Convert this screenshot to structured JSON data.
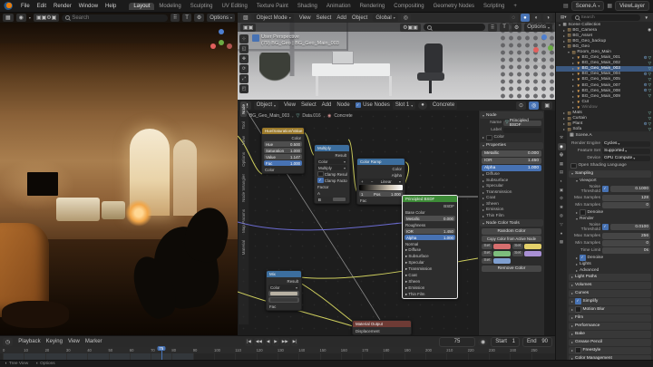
{
  "topbar": {
    "menus": [
      "File",
      "Edit",
      "Render",
      "Window",
      "Help"
    ],
    "workspaces": [
      "Layout",
      "Modeling",
      "Sculpting",
      "UV Editing",
      "Texture Paint",
      "Shading",
      "Animation",
      "Rendering",
      "Compositing",
      "Geometry Nodes",
      "Scripting",
      "+"
    ],
    "active_workspace": "Layout",
    "scene": "Scene.A",
    "viewlayer": "ViewLayer"
  },
  "render_vp": {
    "search_placeholder": "Search",
    "options_label": "Options"
  },
  "solid_vp": {
    "mode": "Object Mode",
    "menus": [
      "View",
      "Select",
      "Add",
      "Object"
    ],
    "orientation": "Global",
    "options_label": "Options",
    "overlay_line1": "User Perspective",
    "overlay_line2": "(79) BG_Geo | BG_Geo_Main_003"
  },
  "shader": {
    "id_type": "Object",
    "menus": [
      "View",
      "Select",
      "Add",
      "Node"
    ],
    "use_nodes_label": "Use Nodes",
    "slot_label": "Slot 1",
    "material_name": "Concrete",
    "breadcrumb": [
      "BG_Geo_Main_003",
      "Data.016",
      "Concrete"
    ],
    "nodes": {
      "hsv": {
        "title": "Hue/Saturation/Value",
        "out": "Color",
        "rows": [
          [
            "Hue",
            "0.500"
          ],
          [
            "Saturation",
            "1.000"
          ],
          [
            "Value",
            "1.147"
          ],
          [
            "Fac",
            "1.000"
          ]
        ],
        "input": "Color"
      },
      "mix": {
        "title": "Multiply",
        "out": "Result",
        "dd1": "Color",
        "dd2": "Multiply",
        "cb1": "Clamp Result",
        "cb2": "Clamp Factor",
        "factor": "Factor",
        "a": "A",
        "b": "B"
      },
      "ramp": {
        "title": "Color Ramp",
        "out1": "Color",
        "out2": "Alpha",
        "interp": "Linear",
        "index": "1",
        "pos_label": "Pos",
        "pos_value": "1.000",
        "input": "Fac"
      },
      "bsdf": {
        "title": "Principled BSDF",
        "out": "BSDF",
        "base_color": "Base Color",
        "roughness": "Roughness",
        "normal": "Normal",
        "rows": [
          [
            "Metallic",
            "0.000"
          ],
          [
            "IOR",
            "1.450"
          ],
          [
            "Alpha",
            "1.000"
          ]
        ],
        "sections": [
          "Diffuse",
          "Subsurface",
          "Specular",
          "Transmission",
          "Coat",
          "Sheen",
          "Emission",
          "Thin Film"
        ]
      },
      "mix2": {
        "title": "Mix",
        "out": "Result",
        "dd": "Color",
        "fac": "Fac"
      },
      "output": {
        "title": "Material Output",
        "row1": "Displacement"
      }
    },
    "sidebar": {
      "tabs": [
        "Node",
        "Tool",
        "View",
        "Options",
        "Node Wrangler",
        "Map Params",
        "Material"
      ],
      "active_tab": "Node",
      "node_panel": {
        "title": "Node",
        "name_label": "Name",
        "name_value": "Principled BSDF",
        "label_label": "Label",
        "color_label": "Color"
      },
      "props_panel": {
        "title": "Properties",
        "rows": [
          [
            "Metallic",
            "0.000"
          ],
          [
            "IOR",
            "1.450"
          ],
          [
            "Alpha",
            "1.000"
          ]
        ],
        "sections": [
          "Diffuse",
          "Subsurface",
          "Specular",
          "Transmission",
          "Coat",
          "Sheen",
          "Emission",
          "Thin Film"
        ]
      },
      "color_tools": {
        "title": "Node Color Tools",
        "random": "Random Color",
        "copy": "Copy Color from Active Node",
        "set": "Set",
        "remove": "Remove Color",
        "swatches": [
          "#d66e6e",
          "#e3d06a",
          "#7dbd7d",
          "#a88fd4",
          "#7f9fd0"
        ]
      }
    }
  },
  "outliner": {
    "search_placeholder": "Search",
    "rows": [
      {
        "d": 0,
        "i": "scene",
        "t": "Scene Collection",
        "open": true
      },
      {
        "d": 1,
        "i": "col",
        "t": "BG_Camera",
        "m": "c"
      },
      {
        "d": 1,
        "i": "col",
        "t": "BG_Asset"
      },
      {
        "d": 1,
        "i": "col",
        "t": "BG_Geo_backup"
      },
      {
        "d": 1,
        "i": "col",
        "t": "BG_Geo",
        "open": true
      },
      {
        "d": 2,
        "i": "col",
        "t": "Room_Geo_Main",
        "open": true
      },
      {
        "d": 3,
        "i": "mesh",
        "t": "BG_Geo_Main_001",
        "m": "wd"
      },
      {
        "d": 3,
        "i": "mesh",
        "t": "BG_Geo_Main_002",
        "m": "d"
      },
      {
        "d": 3,
        "i": "mesh",
        "t": "BG_Geo_Main_003",
        "m": "d",
        "sel": true
      },
      {
        "d": 3,
        "i": "mesh",
        "t": "BG_Geo_Main_004",
        "m": "wd"
      },
      {
        "d": 3,
        "i": "mesh",
        "t": "BG_Geo_Main_005",
        "m": "d"
      },
      {
        "d": 3,
        "i": "mesh",
        "t": "BG_Geo_Main_007",
        "m": "wd"
      },
      {
        "d": 3,
        "i": "mesh",
        "t": "BG_Geo_Main_008",
        "m": "wd"
      },
      {
        "d": 3,
        "i": "mesh",
        "t": "BG_Geo_Main_009",
        "m": "d"
      },
      {
        "d": 3,
        "i": "mesh",
        "t": "Cut"
      },
      {
        "d": 3,
        "i": "mesh",
        "t": "Window",
        "dim": true
      },
      {
        "d": 1,
        "i": "col",
        "t": "Mats",
        "m": "d"
      },
      {
        "d": 1,
        "i": "col",
        "t": "Curtain",
        "m": "d"
      },
      {
        "d": 1,
        "i": "col",
        "t": "Plant",
        "m": "wd"
      },
      {
        "d": 1,
        "i": "col",
        "t": "Sofa",
        "m": "d"
      },
      {
        "d": 1,
        "i": "col",
        "t": "Background",
        "m": "wd"
      }
    ]
  },
  "props": {
    "scene_name": "Scene.A",
    "fields": [
      [
        "Render Engine",
        "Cycles"
      ],
      [
        "Feature Set",
        "Supported"
      ],
      [
        "Device",
        "GPU Compute"
      ]
    ],
    "osl_label": "Open Shading Language",
    "sampling_label": "Sampling",
    "viewport_label": "Viewport",
    "render_label": "Render",
    "viewport_rows": [
      {
        "l": "Noise Threshold",
        "v": "0.1000",
        "check": true
      },
      {
        "l": "Max Samples",
        "v": "128"
      },
      {
        "l": "Min Samples",
        "v": "0"
      }
    ],
    "denoise_mid": "Denoise",
    "render_rows": [
      {
        "l": "Noise Threshold",
        "v": "0.0100",
        "check": true
      },
      {
        "l": "Max Samples",
        "v": "256"
      },
      {
        "l": "Min Samples",
        "v": "0"
      },
      {
        "l": "Time Limit",
        "v": "0s"
      }
    ],
    "sampling_collapsed": [
      {
        "label": "Denoise",
        "check": true
      },
      {
        "label": "Lights"
      },
      {
        "label": "Advanced"
      }
    ],
    "collapsed": [
      {
        "label": "Light Paths"
      },
      {
        "label": "Volumes"
      },
      {
        "label": "Curves"
      },
      {
        "label": "Simplify",
        "check": true
      },
      {
        "label": "Motion Blur",
        "check": false
      },
      {
        "label": "Film"
      },
      {
        "label": "Performance"
      },
      {
        "label": "Bake"
      },
      {
        "label": "Grease Pencil"
      },
      {
        "label": "Freestyle",
        "check": false
      },
      {
        "label": "Color Management"
      }
    ]
  },
  "timeline": {
    "menus": [
      "Playback",
      "Keying",
      "View",
      "Marker"
    ],
    "controls": [
      "|◀",
      "◀◀",
      "◀",
      "▶",
      "▶▶",
      "▶|"
    ],
    "frame": "75",
    "start_label": "Start",
    "start": "1",
    "end_label": "End",
    "end": "90",
    "tick_step": 10,
    "tick_max": 250,
    "playhead_frame": 75,
    "range_end": 90
  },
  "status": {
    "items": [
      "Tree View",
      "Options"
    ]
  },
  "colors": {
    "accent": "#4772b3",
    "selected_row": "#3b5880",
    "node_hsv": "#9c7a2a",
    "node_mix": "#3c6e9e",
    "node_ramp": "#3c6e9e",
    "node_bsdf": "#3d8b37",
    "node_output": "#6e3b35"
  }
}
